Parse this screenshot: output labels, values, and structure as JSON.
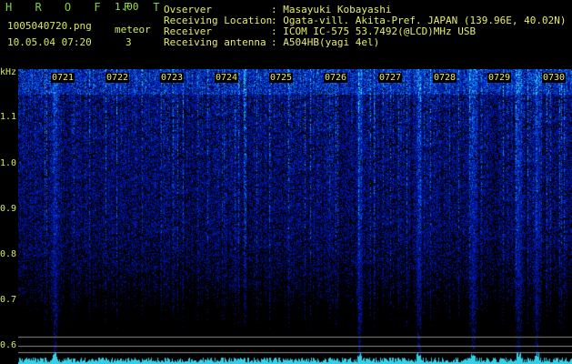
{
  "header": {
    "app_name": "H R O F F T",
    "version": "1.00",
    "filename": "1005040720.png",
    "meteor_label": "meteor",
    "datetime": "10.05.04 07:20",
    "meteor_count": "3"
  },
  "info": [
    {
      "label": "Ovserver",
      "value": ": Masayuki Kobayashi"
    },
    {
      "label": "Receiving Location",
      "value": ": Ogata-vill. Akita-Pref. JAPAN (139.96E, 40.02N)"
    },
    {
      "label": "Receiver",
      "value": ": ICOM IC-575 53.7492(@LCD)MHz USB"
    },
    {
      "label": "Receiving antenna",
      "value": ": A504HB(yagi 4el)"
    }
  ],
  "spectrogram": {
    "unit_label": "kHz",
    "freq_ticks": [
      "1.1",
      "1.0",
      "0.9",
      "0.8",
      "0.7",
      "0.6"
    ],
    "time_ticks": [
      "0721",
      "0722",
      "0723",
      "0724",
      "0725",
      "0726",
      "0727",
      "0728",
      "0729",
      "0730"
    ],
    "colors": {
      "background": "#000000",
      "signal_low": "#0a1a6a",
      "signal_mid": "#1f5fd8",
      "signal_high": "#33d0e8",
      "peak": "#6ef07a",
      "text": "#d8e85a"
    }
  }
}
